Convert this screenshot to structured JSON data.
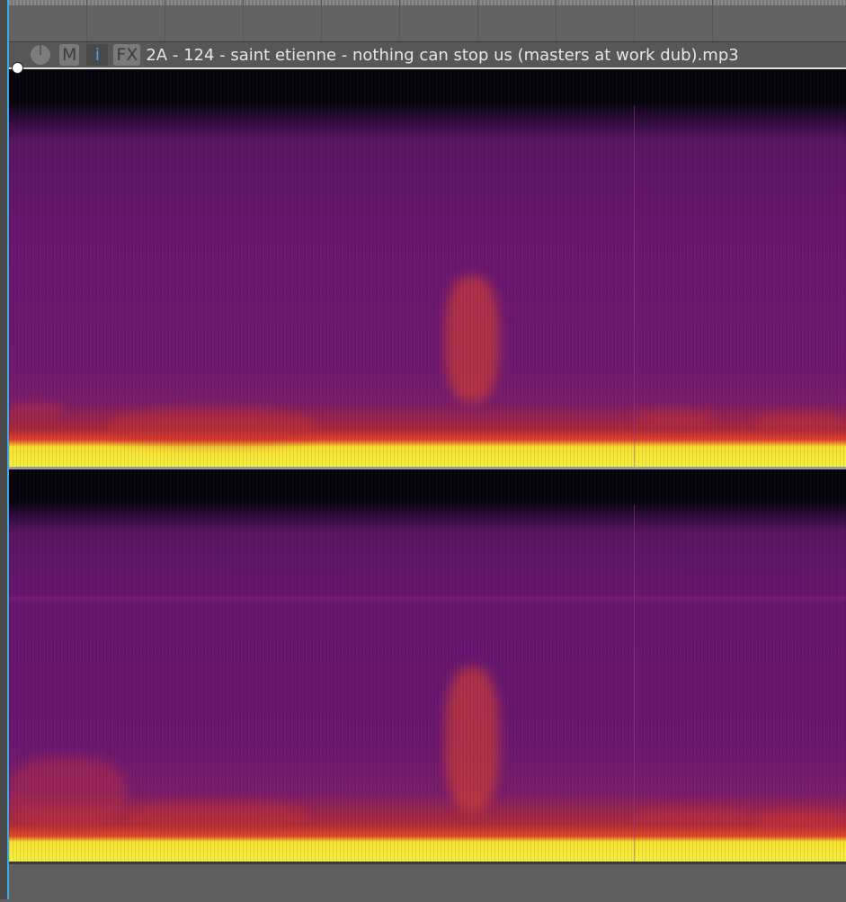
{
  "track": {
    "buttons": {
      "mute": "M",
      "info": "i",
      "fx": "FX"
    },
    "item_title": "2A - 124 - saint etienne - nothing can stop us (masters at work dub).mp3"
  },
  "colors": {
    "accent": "#3fa9e8",
    "spectrogram_low": "#05040a",
    "spectrogram_mid": "#6a1670",
    "spectrogram_high": "#f4f040"
  }
}
